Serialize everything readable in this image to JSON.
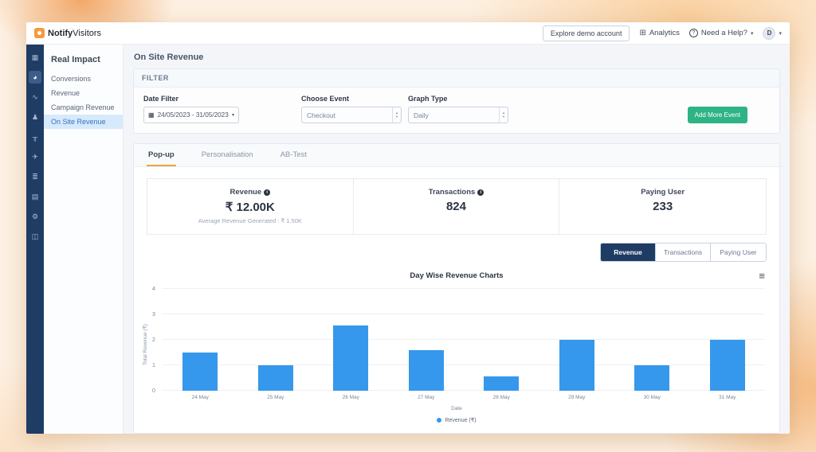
{
  "header": {
    "logo_bold": "Notify",
    "logo_light": "Visitors",
    "explore_button": "Explore demo account",
    "analytics_label": "Analytics",
    "help_label": "Need a Help?",
    "help_glyph": "?",
    "analytics_glyph": "⊞",
    "chevron_glyph": "▾",
    "avatar_initial": "D"
  },
  "icon_rail": {
    "items": [
      {
        "name": "grid-icon",
        "glyph": "▦",
        "active": false
      },
      {
        "name": "dashboard-icon",
        "glyph": "◕",
        "active": true
      },
      {
        "name": "trends-icon",
        "glyph": "∿",
        "active": false
      },
      {
        "name": "users-icon",
        "glyph": "♟",
        "active": false
      },
      {
        "name": "sitemap-icon",
        "glyph": "╥",
        "active": false
      },
      {
        "name": "send-icon",
        "glyph": "✈",
        "active": false
      },
      {
        "name": "list-icon",
        "glyph": "≣",
        "active": false
      },
      {
        "name": "image-icon",
        "glyph": "▤",
        "active": false
      },
      {
        "name": "settings-icon",
        "glyph": "⚙",
        "active": false
      },
      {
        "name": "docs-icon",
        "glyph": "◫",
        "active": false
      }
    ]
  },
  "sidebar": {
    "title": "Real Impact",
    "items": [
      {
        "label": "Conversions",
        "active": false
      },
      {
        "label": "Revenue",
        "active": false
      },
      {
        "label": "Campaign Revenue",
        "active": false
      },
      {
        "label": "On Site Revenue",
        "active": true
      }
    ]
  },
  "page": {
    "title": "On Site Revenue"
  },
  "filter": {
    "title": "FILTER",
    "date_label": "Date Filter",
    "date_value": "24/05/2023 - 31/05/2023",
    "calendar_glyph": "▦",
    "caret_glyph": "▾",
    "event_label": "Choose Event",
    "event_value": "Checkout",
    "graph_label": "Graph Type",
    "graph_value": "Daily",
    "add_button": "Add More Event"
  },
  "tabs": [
    {
      "label": "Pop-up",
      "active": true
    },
    {
      "label": "Personalisation",
      "active": false
    },
    {
      "label": "AB-Test",
      "active": false
    }
  ],
  "stats": [
    {
      "label": "Revenue",
      "info": true,
      "value": "₹ 12.00K",
      "sub": "Average Revenue Generated : ₹ 1.50K"
    },
    {
      "label": "Transactions",
      "info": true,
      "value": "824",
      "sub": ""
    },
    {
      "label": "Paying User",
      "info": false,
      "value": "233",
      "sub": ""
    }
  ],
  "chart_toggle": [
    {
      "label": "Revenue",
      "active": true
    },
    {
      "label": "Transactions",
      "active": false
    },
    {
      "label": "Paying User",
      "active": false
    }
  ],
  "chart_data": {
    "type": "bar",
    "title": "Day Wise Revenue Charts",
    "categories": [
      "24 May",
      "25 May",
      "26 May",
      "27 May",
      "28 May",
      "29 May",
      "30 May",
      "31 May"
    ],
    "values": [
      1.5,
      1,
      2.55,
      1.6,
      0.55,
      2,
      1,
      2
    ],
    "xlabel": "Date",
    "ylabel": "Total Revenue (₹)",
    "ylim": [
      0,
      4
    ],
    "yticks": [
      0,
      1,
      2,
      3,
      4
    ],
    "legend": [
      "Revenue (₹)"
    ],
    "bar_color": "#3598ec",
    "grid": true,
    "legend_position": "bottom"
  }
}
